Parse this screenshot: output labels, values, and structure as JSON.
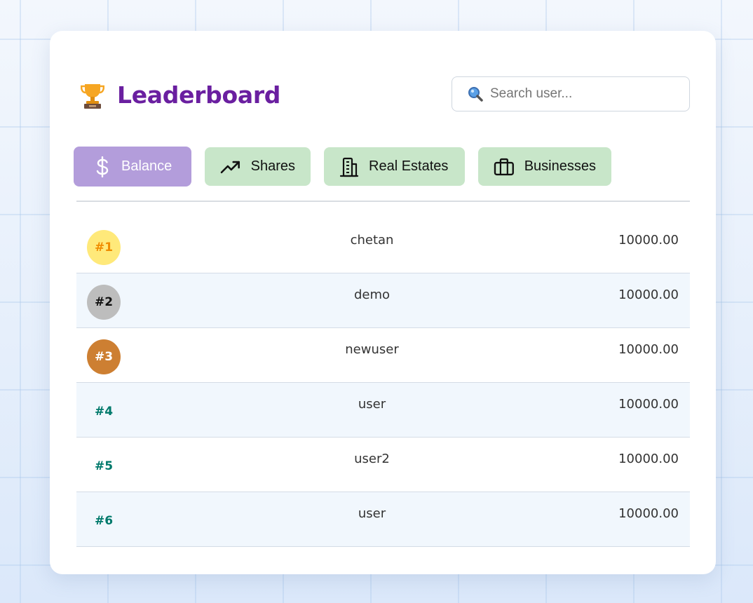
{
  "header": {
    "title": "Leaderboard",
    "trophy_icon": "trophy-icon"
  },
  "search": {
    "placeholder": "Search user...",
    "value": "",
    "icon": "magnifier-icon"
  },
  "tabs": [
    {
      "label": "Balance",
      "icon": "dollar-icon",
      "active": true
    },
    {
      "label": "Shares",
      "icon": "trending-up-icon",
      "active": false
    },
    {
      "label": "Real Estates",
      "icon": "building-icon",
      "active": false
    },
    {
      "label": "Businesses",
      "icon": "briefcase-icon",
      "active": false
    }
  ],
  "colors": {
    "title": "#6a1fa0",
    "tab_active": "#b39ddb",
    "tab_inactive": "#c8e6c9",
    "gold": "#ffe97a",
    "silver": "#bdbdbd",
    "bronze": "#cd7f32",
    "rank_text": "#00796b",
    "row_alt": "#f1f7fd"
  },
  "rows": [
    {
      "rank": "#1",
      "user": "chetan",
      "amount": "10000.00"
    },
    {
      "rank": "#2",
      "user": "demo",
      "amount": "10000.00"
    },
    {
      "rank": "#3",
      "user": "newuser",
      "amount": "10000.00"
    },
    {
      "rank": "#4",
      "user": "user",
      "amount": "10000.00"
    },
    {
      "rank": "#5",
      "user": "user2",
      "amount": "10000.00"
    },
    {
      "rank": "#6",
      "user": "user",
      "amount": "10000.00"
    }
  ]
}
